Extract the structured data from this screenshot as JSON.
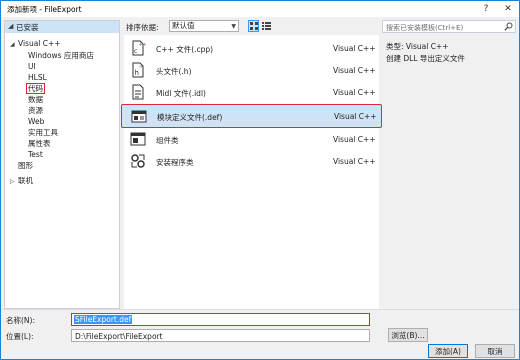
{
  "window": {
    "title": "添加新项 - FileExport",
    "help": "?",
    "close": "✕"
  },
  "tree": {
    "header": "已安装",
    "items": [
      {
        "label": "Visual C++",
        "expand": "◢"
      },
      {
        "label": "Windows 应用商店"
      },
      {
        "label": "UI"
      },
      {
        "label": "HLSL"
      },
      {
        "label": "代码"
      },
      {
        "label": "数据"
      },
      {
        "label": "资源"
      },
      {
        "label": "Web"
      },
      {
        "label": "实用工具"
      },
      {
        "label": "属性表"
      },
      {
        "label": "Test"
      },
      {
        "label": "图形"
      },
      {
        "label": "联机",
        "expand": "▷"
      }
    ]
  },
  "toolbar": {
    "sort_label": "排序依据:",
    "sort_value": "默认值"
  },
  "search": {
    "placeholder": "搜索已安装模板(Ctrl+E)"
  },
  "templates": [
    {
      "name": "C++ 文件(.cpp)",
      "lang": "Visual C++",
      "icon": "cpp-file-icon"
    },
    {
      "name": "头文件(.h)",
      "lang": "Visual C++",
      "icon": "header-file-icon"
    },
    {
      "name": "Midl 文件(.idl)",
      "lang": "Visual C++",
      "icon": "midl-file-icon"
    },
    {
      "name": "模块定义文件(.def)",
      "lang": "Visual C++",
      "icon": "module-def-file-icon"
    },
    {
      "name": "组件类",
      "lang": "Visual C++",
      "icon": "component-class-icon"
    },
    {
      "name": "安装程序类",
      "lang": "Visual C++",
      "icon": "installer-class-icon"
    }
  ],
  "details": {
    "type_label": "类型:",
    "type_value": "Visual C++",
    "description": "创建 DLL 导出定义文件"
  },
  "form": {
    "name_label": "名称(N):",
    "name_value": "SFileExport.def",
    "location_label": "位置(L):",
    "location_value": "D:\\FileExport\\FileExport",
    "browse_label": "浏览(B)...",
    "add_label": "添加(A)",
    "cancel_label": "取消"
  },
  "colors": {
    "accent": "#1883d7",
    "selection": "#cce4f7",
    "highlight_border": "#e32636"
  }
}
